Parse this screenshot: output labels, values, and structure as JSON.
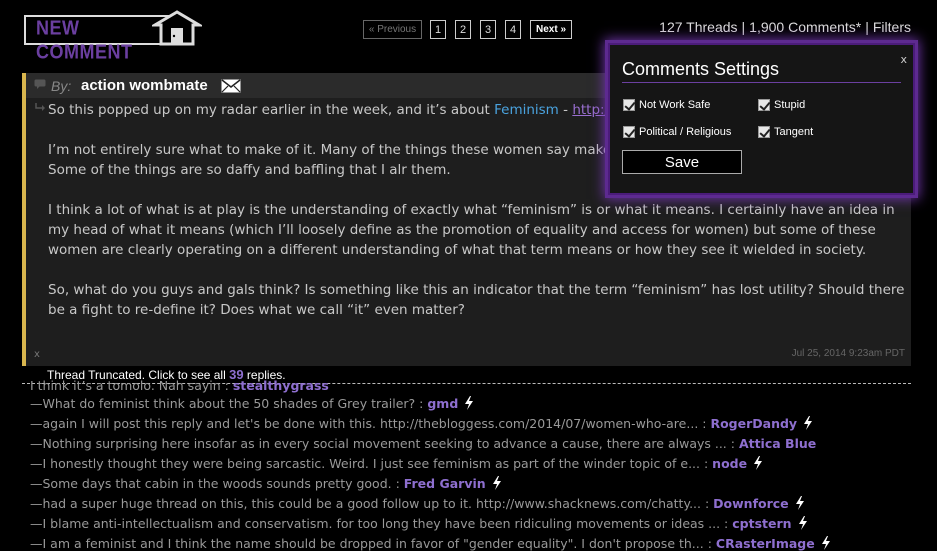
{
  "logo": {
    "text": "NEW COMMENT"
  },
  "pager": {
    "previous": "« Previous",
    "pages": [
      "1",
      "2",
      "3",
      "4"
    ],
    "next": "Next »"
  },
  "stats": {
    "threads": "127 Threads",
    "comments": "1,900 Comments*",
    "filters": "Filters"
  },
  "post": {
    "by_label": "By:",
    "author": "action wombmate",
    "paragraph1_prefix": "So this popped up on my radar earlier in the week, and it’s about ",
    "paragraph1_link": "Feminism",
    "paragraph1_dash": " - ",
    "paragraph1_url": "http://wo",
    "paragraph2": "I’m not entirely sure what to make of it. Many of the things these women say make abs with feminism as I understand it. Some of the things are so daffy and baffling that I alr them.",
    "paragraph3": "I think a lot of what is at play is the understanding of exactly what “feminism” is or what it means. I certainly have an idea in my head of what it means (which I’ll loosely define as the promotion of equality and access for women) but some of these women are clearly operating on a different understanding of what that term means or how they see it wielded in society.",
    "paragraph4": "So, what do you guys and gals think? Is something like this an indicator that the term “feminism” has lost utility? Should there be a fight to re-define it? Does what we call “it” even matter?",
    "close_x": "x",
    "date": "Jul 25, 2014 9:23am PDT"
  },
  "truncated": {
    "prefix": "Thread Truncated. Click to see all ",
    "count": "39",
    "suffix": " replies."
  },
  "replies": [
    {
      "text": "I think it’s a tomolo. Nah sayin : ",
      "author": "stealthygrass"
    },
    {
      "text": "—What do feminist think about the 50 shades of Grey trailer? : ",
      "author": "gmd"
    },
    {
      "text": "—again I will post this reply and let's be done with this. http://thebloggess.com/2014/07/women-who-are... : ",
      "author": "RogerDandy"
    },
    {
      "text": "—Nothing surprising here insofar as in every social movement seeking to advance a cause, there are always ... : ",
      "author": "Attica Blue"
    },
    {
      "text": "—I honestly thought they were being sarcastic. Weird. I just see feminism as part of the winder topic of e... : ",
      "author": "node"
    },
    {
      "text": "—Some days that cabin in the woods sounds pretty good. : ",
      "author": "Fred Garvin"
    },
    {
      "text": "—had a super huge thread on this, this could be a good follow up to it. http://www.shacknews.com/chatty... : ",
      "author": "Downforce"
    },
    {
      "text": "—I blame anti-intellectualism and conservatism. for too long they have been ridiculing movements or ideas ... : ",
      "author": "cptstern"
    },
    {
      "text": "—I am a feminist and I think the name should be dropped in favor of \"gender equality\". I don't propose th... : ",
      "author": "CRasterImage"
    }
  ],
  "settings": {
    "title": "Comments Settings",
    "close": "x",
    "options": [
      {
        "label": "Not Work Safe",
        "checked": true
      },
      {
        "label": "Stupid",
        "checked": true
      },
      {
        "label": "Political / Religious",
        "checked": true
      },
      {
        "label": "Tangent",
        "checked": true
      }
    ],
    "save": "Save"
  },
  "colors": {
    "accent_purple": "#6b3fa0",
    "author_purple": "#8e6fcf",
    "post_border": "#d9b64e",
    "link_blue": "#4aa3df"
  }
}
